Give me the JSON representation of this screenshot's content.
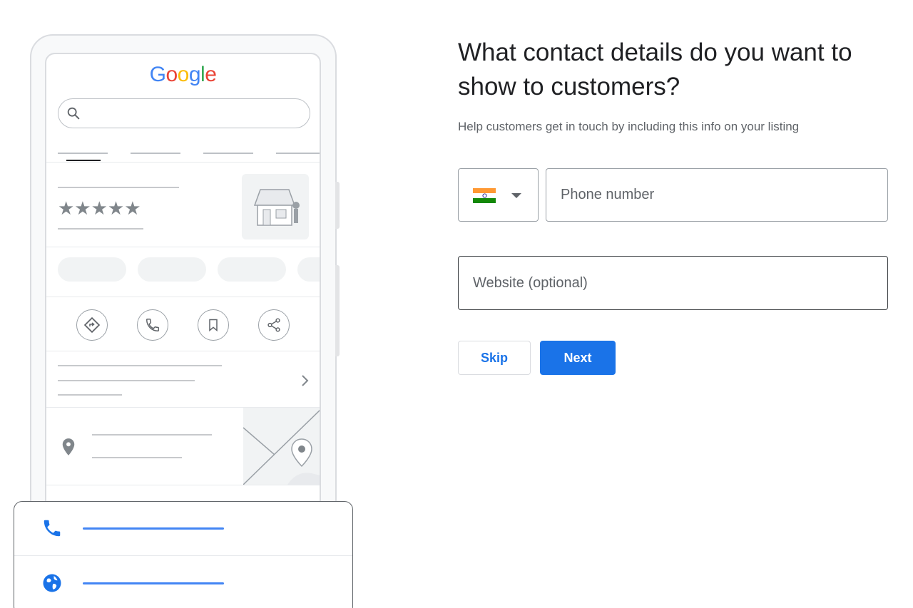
{
  "illustration": {
    "logo_letters": [
      {
        "char": "G",
        "color": "#4285F4"
      },
      {
        "char": "o",
        "color": "#EA4335"
      },
      {
        "char": "o",
        "color": "#FBBC05"
      },
      {
        "char": "g",
        "color": "#4285F4"
      },
      {
        "char": "l",
        "color": "#34A853"
      },
      {
        "char": "e",
        "color": "#EA4335"
      }
    ],
    "rating_stars": "★★★★★",
    "contact_card": {
      "rows": [
        {
          "icon": "phone-icon",
          "accent": "#1a73e8"
        },
        {
          "icon": "globe-icon",
          "accent": "#1a73e8"
        }
      ]
    }
  },
  "form": {
    "heading": "What contact details do you want to show to customers?",
    "subtext": "Help customers get in touch by including this info on your listing",
    "country": {
      "flag": "india-flag-icon",
      "flag_colors": [
        "#FF9933",
        "#FFFFFF",
        "#138808"
      ]
    },
    "phone": {
      "placeholder": "Phone number",
      "value": ""
    },
    "website": {
      "placeholder": "Website (optional)",
      "value": ""
    },
    "skip_label": "Skip",
    "next_label": "Next"
  },
  "colors": {
    "accent": "#1a73e8",
    "text": "#202124",
    "muted": "#5f6368"
  }
}
